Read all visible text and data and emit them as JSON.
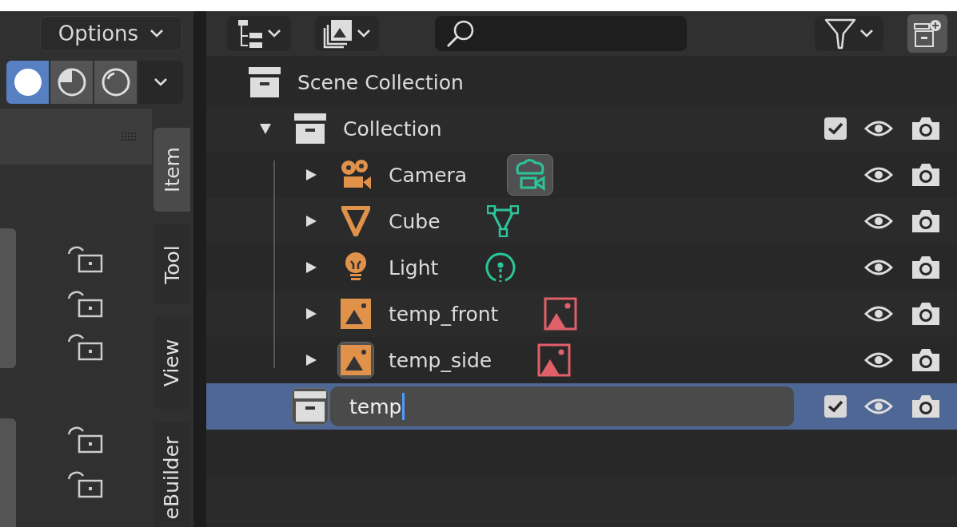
{
  "sidebar": {
    "options_button": "Options",
    "shading_modes": [
      {
        "selected": true
      },
      {
        "selected": false
      },
      {
        "selected": false
      }
    ],
    "tabs": [
      {
        "label": "Item",
        "selected": true
      },
      {
        "label": "Tool",
        "selected": false
      },
      {
        "label": "View",
        "selected": false
      },
      {
        "label": "eBuilder",
        "selected": false
      }
    ]
  },
  "outliner": {
    "tree": [
      {
        "name": "Scene Collection",
        "kind": "scene",
        "children": [
          {
            "name": "Collection",
            "kind": "collection",
            "expanded": true,
            "checked": true,
            "children": [
              {
                "name": "Camera",
                "kind": "camera",
                "expanded": false,
                "data_active": true,
                "object_active": false
              },
              {
                "name": "Cube",
                "kind": "mesh",
                "expanded": false,
                "data_active": false,
                "object_active": false
              },
              {
                "name": "Light",
                "kind": "light",
                "expanded": false,
                "data_active": false,
                "object_active": false
              },
              {
                "name": "temp_front",
                "kind": "image",
                "expanded": false,
                "data_active": false,
                "object_active": false
              },
              {
                "name": "temp_side",
                "kind": "image",
                "expanded": false,
                "data_active": false,
                "object_active": true
              }
            ]
          },
          {
            "name": "temp",
            "kind": "collection",
            "checked": true,
            "selected": true,
            "editing": true
          }
        ]
      }
    ]
  }
}
